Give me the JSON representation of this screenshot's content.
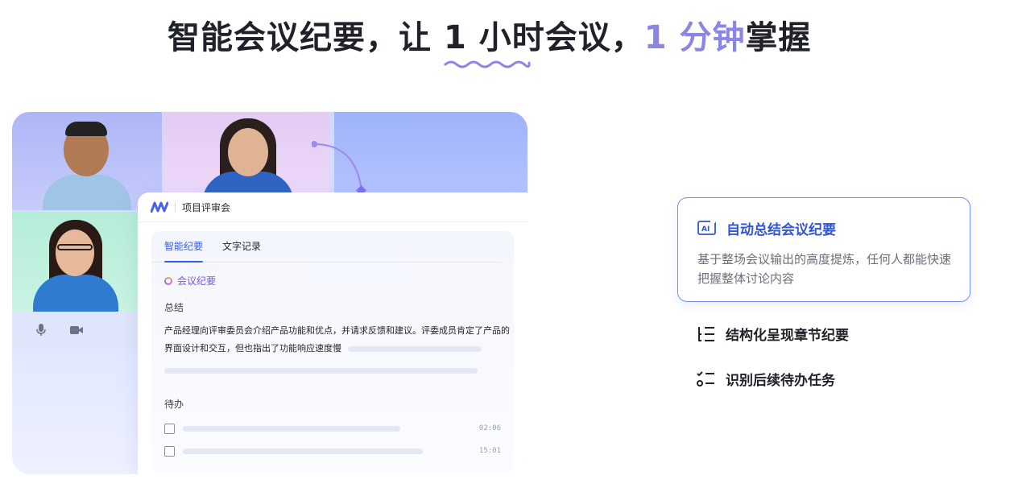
{
  "headline": {
    "part1": "智能会议纪要，让 ",
    "part2": "1 小时会议",
    "part3": "，",
    "part4": "1 分钟",
    "part5": "掌握"
  },
  "meeting_card": {
    "title": "项目评审会",
    "tabs": [
      {
        "label": "智能纪要",
        "active": true
      },
      {
        "label": "文字记录",
        "active": false
      }
    ],
    "section_label": "会议纪要",
    "summary_heading": "总结",
    "summary_text": "产品经理向评审委员会介绍产品功能和优点，并请求反馈和建议。评委成员肯定了产品的界面设计和交互，但也指出了功能响应速度慢",
    "todo_heading": "待办",
    "todos": [
      {
        "time": "02:06"
      },
      {
        "time": "15:01"
      }
    ]
  },
  "features": {
    "highlight": {
      "icon": "ai-icon",
      "title": "自动总结会议纪要",
      "description": "基于整场会议输出的高度提炼，任何人都能快速把握整体讨论内容"
    },
    "items": [
      {
        "icon": "structured-list-icon",
        "label": "结构化呈现章节纪要"
      },
      {
        "icon": "checklist-icon",
        "label": "识别后续待办任务"
      }
    ]
  },
  "colors": {
    "accent_blue": "#2f55d4",
    "accent_purple": "#8b85e6",
    "headline_text": "#1f2329"
  }
}
